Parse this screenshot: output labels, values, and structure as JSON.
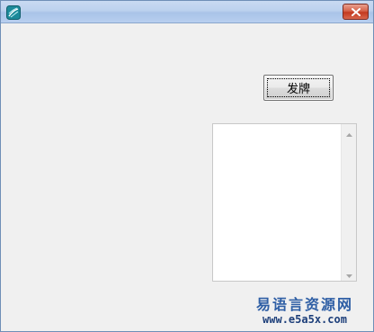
{
  "window": {
    "app_icon": "app-logo-icon",
    "close_icon": "close-icon"
  },
  "main": {
    "deal_button_label": "发牌",
    "listbox_items": []
  },
  "watermark": {
    "site_name": "易语言资源网",
    "site_url": "www.e5a5x.com"
  },
  "colors": {
    "titlebar": "#bcd1ee",
    "close_button": "#c3391f",
    "window_bg": "#f0f0f0",
    "watermark_text": "#2f5fa5"
  }
}
